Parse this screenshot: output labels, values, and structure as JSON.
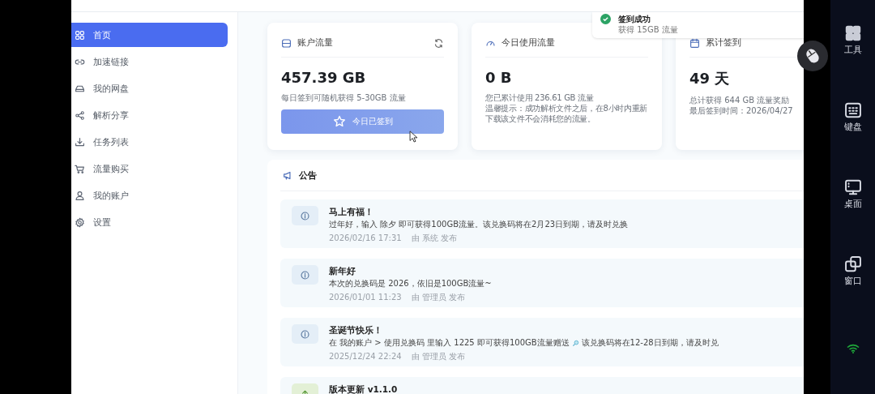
{
  "sidebar": {
    "items": [
      {
        "label": "首页",
        "selected": true
      },
      {
        "label": "加速链接",
        "selected": false
      },
      {
        "label": "我的网盘",
        "selected": false
      },
      {
        "label": "解析分享",
        "selected": false
      },
      {
        "label": "任务列表",
        "selected": false
      },
      {
        "label": "流量购买",
        "selected": false
      },
      {
        "label": "我的账户",
        "selected": false
      },
      {
        "label": "设置",
        "selected": false
      }
    ]
  },
  "toast": {
    "title": "签到成功",
    "message": "获得 15GB 流量"
  },
  "cards": [
    {
      "title": "账户流量",
      "value": "457.39 GB",
      "lines": [
        "每日签到可随机获得 5-30GB 流量"
      ],
      "button": {
        "label": "今日已签到",
        "disabled": true
      }
    },
    {
      "title": "今日使用流量",
      "value": "0 B",
      "lines": [
        "您已累计使用 236.61 GB 流量",
        "温馨提示：成功解析文件之后，在8小时内重新下载该文件不会消耗您的流量。"
      ]
    },
    {
      "title": "累计签到",
      "value": "49 天",
      "lines": [
        "总计获得 644 GB 流量奖励",
        "最后签到时间：2026/04/27"
      ]
    }
  ],
  "announcements": {
    "title": "公告",
    "items": [
      {
        "kind": "info",
        "title": "马上有福！",
        "body": [
          "过年好，输入 除夕 即可获得100GB流量。该兑换码将在2月23日到期，请及时兑换"
        ],
        "date": "2026/02/16 17:31",
        "author": "由 系统 发布"
      },
      {
        "kind": "info",
        "title": "新年好",
        "body": [
          "本次的兑换码是 2026，依旧是100GB流量~"
        ],
        "date": "2026/01/01 11:23",
        "author": "由 管理员 发布"
      },
      {
        "kind": "info",
        "title": "圣诞节快乐！",
        "body": [
          "在 我的账户 > 使用兑换码 里输入 1225 即可获得100GB流量赠送",
          "该兑换码将在12-28日到期，请及时兑"
        ],
        "date": "2025/12/24 22:24",
        "author": "由 管理员 发布"
      },
      {
        "kind": "update",
        "title": "版本更新 v1.1.0"
      }
    ]
  },
  "side_panel": {
    "items": [
      {
        "label": "工具"
      },
      {
        "label": "键盘"
      },
      {
        "label": "桌面"
      },
      {
        "label": "窗口"
      }
    ]
  }
}
